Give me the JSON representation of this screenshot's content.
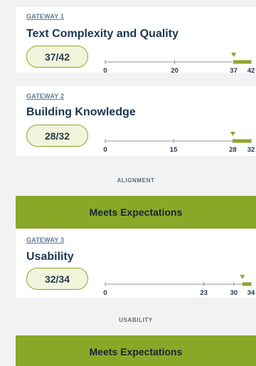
{
  "gateways": [
    {
      "label": "GATEWAY 1",
      "title": "Text Complexity and Quality",
      "score": "37/42",
      "ticks": [
        "0",
        "20",
        "37",
        "42"
      ],
      "tick_values": [
        0,
        20,
        37,
        42
      ],
      "score_value": 37,
      "max_value": 42
    },
    {
      "label": "GATEWAY 2",
      "title": "Building Knowledge",
      "score": "28/32",
      "ticks": [
        "0",
        "15",
        "28",
        "32"
      ],
      "tick_values": [
        0,
        15,
        28,
        32
      ],
      "score_value": 28,
      "max_value": 32
    },
    {
      "label": "GATEWAY 3",
      "title": "Usability",
      "score": "32/34",
      "ticks": [
        "0",
        "23",
        "30",
        "34"
      ],
      "tick_values": [
        0,
        23,
        30,
        34
      ],
      "score_value": 32,
      "max_value": 34
    }
  ],
  "alignment": {
    "label": "ALIGNMENT",
    "rating": "Meets Expectations"
  },
  "usability": {
    "label": "USABILITY",
    "rating": "Meets Expectations"
  },
  "colors": {
    "accent": "#8aa827",
    "title": "#1d3552",
    "link": "#5e7a9a"
  }
}
